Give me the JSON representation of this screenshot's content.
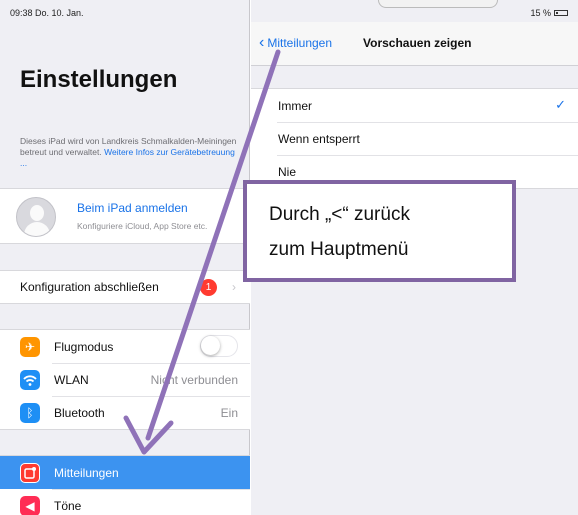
{
  "status": {
    "time": "09:38  Do. 10. Jan.",
    "battery": "15 %"
  },
  "left": {
    "title": "Einstellungen",
    "info_text": "Dieses iPad wird von Landkreis Schmalkalden-Meiningen betreut und verwaltet. ",
    "info_link": "Weitere Infos zur Gerätebetreuung ...",
    "account_title": "Beim iPad anmelden",
    "account_sub": "Konfiguriere iCloud, App Store etc.",
    "config_label": "Konfiguration abschließen",
    "config_badge": "1",
    "rows": [
      {
        "label": "Flugmodus",
        "value": ""
      },
      {
        "label": "WLAN",
        "value": "Nicht verbunden"
      },
      {
        "label": "Bluetooth",
        "value": "Ein"
      }
    ],
    "bottom_rows": [
      {
        "label": "Mitteilungen"
      },
      {
        "label": "Töne"
      }
    ]
  },
  "right": {
    "back_label": "Mitteilungen",
    "title": "Vorschauen zeigen",
    "options": [
      {
        "label": "Immer"
      },
      {
        "label": "Wenn entsperrt"
      },
      {
        "label": "Nie"
      }
    ]
  },
  "callout": {
    "line1": "Durch „<“ zurück",
    "line2": "zum Hauptmenü"
  },
  "colors": {
    "accent": "#1a73e8",
    "selected": "#3c93f0",
    "callout_border": "#8064a2",
    "arrow": "#8f72b8",
    "badge": "#ff3b30"
  }
}
